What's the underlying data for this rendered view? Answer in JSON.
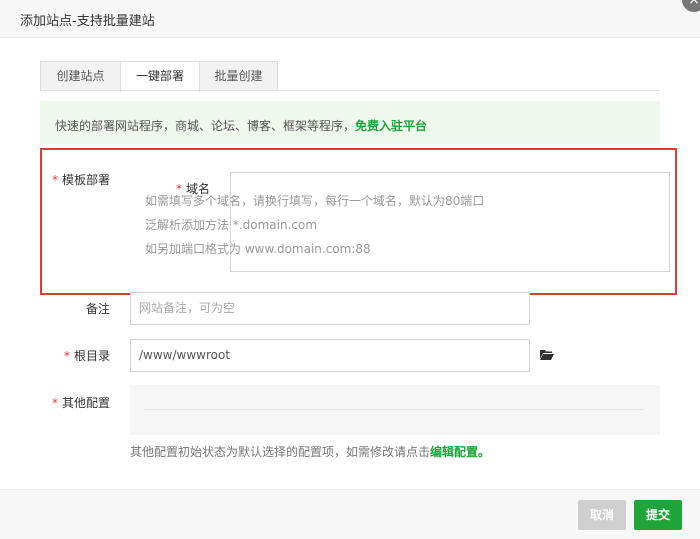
{
  "window": {
    "title": "添加站点-支持批量建站",
    "close_symbol": "×"
  },
  "tabs": [
    {
      "label": "创建站点",
      "active": false
    },
    {
      "label": "一键部署",
      "active": true
    },
    {
      "label": "批量创建",
      "active": false
    }
  ],
  "tip": {
    "text": "快速的部署网站程序，商城、论坛、博客、框架等程序，",
    "link": "免费入驻平台"
  },
  "form": {
    "template": {
      "required": "*",
      "label": "模板部署"
    },
    "domain": {
      "required": "*",
      "label": "域名",
      "hint_lines": [
        "如需填写多个域名，请换行填写，每行一个域名，默认为80端口",
        "泛解析添加方法 *.domain.com",
        "如另加端口格式为 www.domain.com:88"
      ]
    },
    "remark": {
      "label": "备注",
      "placeholder": "网站备注，可为空"
    },
    "root": {
      "required": "*",
      "label": "根目录",
      "value": "/www/wwwroot",
      "icon": "folder-open-icon"
    },
    "other": {
      "required": "*",
      "label": "其他配置",
      "hint": "其他配置初始状态为默认选择的配置项，如需修改请点击",
      "hint_link": "编辑配置。"
    }
  },
  "footer": {
    "cancel_label": "取消",
    "submit_label": "提交"
  },
  "colors": {
    "accent": "#20a53a",
    "highlight_border": "#e03a3a",
    "tip_bg": "#eef8ec"
  }
}
